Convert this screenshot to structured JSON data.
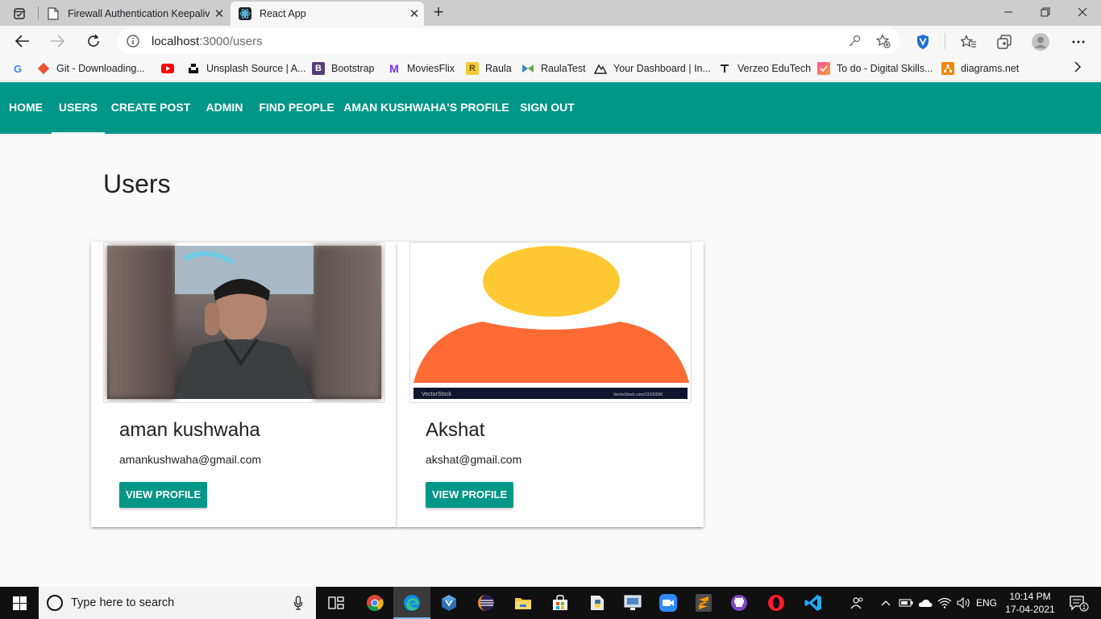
{
  "browser": {
    "tabs": [
      {
        "title": "Firewall Authentication Keepalive",
        "active": false
      },
      {
        "title": "React App",
        "active": true
      }
    ],
    "url_host": "localhost",
    "url_path": ":3000/users",
    "bookmarks": [
      {
        "label": "",
        "icon": "google-icon"
      },
      {
        "label": "Git - Downloading...",
        "icon": "git-icon"
      },
      {
        "label": "",
        "icon": "youtube-icon"
      },
      {
        "label": "Unsplash Source | A...",
        "icon": "unsplash-icon"
      },
      {
        "label": "Bootstrap",
        "icon": "bootstrap-icon"
      },
      {
        "label": "MoviesFlix",
        "icon": "moviesflix-icon"
      },
      {
        "label": "Raula",
        "icon": "raula-icon"
      },
      {
        "label": "RaulaTest",
        "icon": "raulatest-icon"
      },
      {
        "label": "Your Dashboard | In...",
        "icon": "dashboard-icon"
      },
      {
        "label": "Verzeo EduTech",
        "icon": "verzeo-icon"
      },
      {
        "label": "To do - Digital Skills...",
        "icon": "todo-icon"
      },
      {
        "label": "diagrams.net",
        "icon": "diagrams-icon"
      }
    ]
  },
  "nav": {
    "items": [
      {
        "label": "HOME",
        "active": false
      },
      {
        "label": "USERS",
        "active": true
      },
      {
        "label": "CREATE POST",
        "active": false
      },
      {
        "label": "ADMIN",
        "active": false
      },
      {
        "label": "FIND PEOPLE",
        "active": false
      },
      {
        "label": "AMAN KUSHWAHA'S PROFILE",
        "active": false
      },
      {
        "label": "SIGN OUT",
        "active": false
      }
    ],
    "color": "#009688"
  },
  "page": {
    "title": "Users"
  },
  "users": [
    {
      "name": "aman kushwaha",
      "email": "amankushwaha@gmail.com",
      "button": "VIEW PROFILE",
      "image": "profile-photo"
    },
    {
      "name": "Akshat",
      "email": "akshat@gmail.com",
      "button": "VIEW PROFILE",
      "image": "default-avatar",
      "watermark_left": "VectorStock",
      "watermark_right": "VectorStock.com/13336596"
    }
  ],
  "taskbar": {
    "search_placeholder": "Type here to search",
    "language": "ENG",
    "time": "10:14 PM",
    "date": "17-04-2021",
    "notification_count": "1"
  },
  "colors": {
    "accent": "#009688",
    "avatar_head": "#ffc933",
    "avatar_body": "#ff6b35"
  }
}
